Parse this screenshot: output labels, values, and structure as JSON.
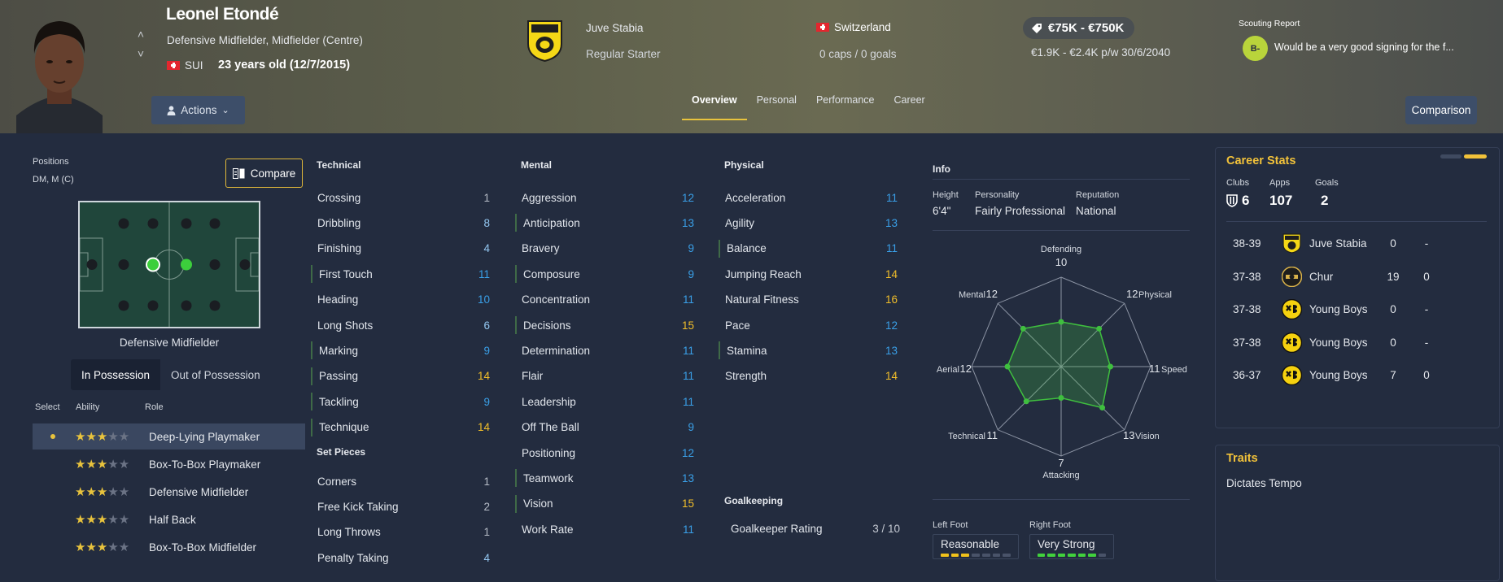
{
  "player": {
    "name": "Leonel Etondé",
    "positions_text": "Defensive Midfielder, Midfielder (Centre)",
    "nationality": "SUI",
    "age_text": "23 years old (12/7/2015)"
  },
  "header": {
    "actions_label": "Actions",
    "club": {
      "name": "Juve Stabia",
      "role": "Regular Starter"
    },
    "international": {
      "country": "Switzerland",
      "caps": "0 caps / 0 goals"
    },
    "value": "€75K - €750K",
    "wage_contract": "€1.9K - €2.4K p/w 30/6/2040",
    "scouting": {
      "title": "Scouting Report",
      "grade": "B-",
      "text": "Would be a very good signing for the f..."
    },
    "tabs": [
      "Overview",
      "Personal",
      "Performance",
      "Career"
    ],
    "active_tab": "Overview",
    "comparison_label": "Comparison"
  },
  "positions": {
    "label": "Positions",
    "value": "DM, M (C)",
    "compare_label": "Compare",
    "selected_role": "Defensive Midfielder",
    "possession_tabs": [
      "In Possession",
      "Out of Possession"
    ],
    "roles_headers": {
      "select": "Select",
      "ability": "Ability",
      "role": "Role"
    },
    "roles": [
      {
        "name": "Deep-Lying Playmaker",
        "stars": 2.5,
        "selected": true
      },
      {
        "name": "Box-To-Box Playmaker",
        "stars": 2.5,
        "selected": false
      },
      {
        "name": "Defensive Midfielder",
        "stars": 2.5,
        "selected": false
      },
      {
        "name": "Half Back",
        "stars": 2.5,
        "selected": false
      },
      {
        "name": "Box-To-Box Midfielder",
        "stars": 2.5,
        "selected": false
      }
    ]
  },
  "technical": {
    "title": "Technical",
    "attrs": [
      {
        "name": "Crossing",
        "value": "1",
        "c": "w"
      },
      {
        "name": "Dribbling",
        "value": "8",
        "c": "lb"
      },
      {
        "name": "Finishing",
        "value": "4",
        "c": "lb"
      },
      {
        "name": "First Touch",
        "value": "11",
        "c": "b",
        "mark": true
      },
      {
        "name": "Heading",
        "value": "10",
        "c": "b"
      },
      {
        "name": "Long Shots",
        "value": "6",
        "c": "lb"
      },
      {
        "name": "Marking",
        "value": "9",
        "c": "b",
        "mark": true
      },
      {
        "name": "Passing",
        "value": "14",
        "c": "y",
        "mark": true
      },
      {
        "name": "Tackling",
        "value": "9",
        "c": "b",
        "mark": true
      },
      {
        "name": "Technique",
        "value": "14",
        "c": "y",
        "mark": true
      }
    ]
  },
  "set_pieces": {
    "title": "Set Pieces",
    "attrs": [
      {
        "name": "Corners",
        "value": "1",
        "c": "w"
      },
      {
        "name": "Free Kick Taking",
        "value": "2",
        "c": "w"
      },
      {
        "name": "Long Throws",
        "value": "1",
        "c": "w"
      },
      {
        "name": "Penalty Taking",
        "value": "4",
        "c": "lb"
      }
    ]
  },
  "mental": {
    "title": "Mental",
    "attrs": [
      {
        "name": "Aggression",
        "value": "12",
        "c": "b"
      },
      {
        "name": "Anticipation",
        "value": "13",
        "c": "b",
        "mark": true
      },
      {
        "name": "Bravery",
        "value": "9",
        "c": "b"
      },
      {
        "name": "Composure",
        "value": "9",
        "c": "b",
        "mark": true
      },
      {
        "name": "Concentration",
        "value": "11",
        "c": "b"
      },
      {
        "name": "Decisions",
        "value": "15",
        "c": "y",
        "mark": true
      },
      {
        "name": "Determination",
        "value": "11",
        "c": "b"
      },
      {
        "name": "Flair",
        "value": "11",
        "c": "b"
      },
      {
        "name": "Leadership",
        "value": "11",
        "c": "b"
      },
      {
        "name": "Off The Ball",
        "value": "9",
        "c": "b"
      },
      {
        "name": "Positioning",
        "value": "12",
        "c": "b"
      },
      {
        "name": "Teamwork",
        "value": "13",
        "c": "b",
        "mark": true
      },
      {
        "name": "Vision",
        "value": "15",
        "c": "y",
        "mark": true
      },
      {
        "name": "Work Rate",
        "value": "11",
        "c": "b"
      }
    ]
  },
  "physical": {
    "title": "Physical",
    "attrs": [
      {
        "name": "Acceleration",
        "value": "11",
        "c": "b"
      },
      {
        "name": "Agility",
        "value": "13",
        "c": "b"
      },
      {
        "name": "Balance",
        "value": "11",
        "c": "b",
        "mark": true
      },
      {
        "name": "Jumping Reach",
        "value": "14",
        "c": "y"
      },
      {
        "name": "Natural Fitness",
        "value": "16",
        "c": "y"
      },
      {
        "name": "Pace",
        "value": "12",
        "c": "b"
      },
      {
        "name": "Stamina",
        "value": "13",
        "c": "b",
        "mark": true
      },
      {
        "name": "Strength",
        "value": "14",
        "c": "y"
      }
    ]
  },
  "goalkeeping": {
    "title": "Goalkeeping",
    "label": "Goalkeeper Rating",
    "value": "3 / 10"
  },
  "info": {
    "title": "Info",
    "height_label": "Height",
    "height": "6'4\"",
    "personality_label": "Personality",
    "personality": "Fairly Professional",
    "reputation_label": "Reputation",
    "reputation": "National",
    "left_foot_label": "Left Foot",
    "left_foot": "Reasonable",
    "left_foot_level": 3,
    "right_foot_label": "Right Foot",
    "right_foot": "Very Strong",
    "right_foot_level": 6
  },
  "radar": {
    "axes": [
      {
        "label": "Defending",
        "value": "10",
        "v": 10
      },
      {
        "label": "Physical",
        "value": "12",
        "v": 12
      },
      {
        "label": "Speed",
        "value": "11",
        "v": 11
      },
      {
        "label": "Vision",
        "value": "13",
        "v": 13
      },
      {
        "label": "Attacking",
        "value": "7",
        "v": 7
      },
      {
        "label": "Technical",
        "value": "11",
        "v": 11
      },
      {
        "label": "Aerial",
        "value": "12",
        "v": 12
      },
      {
        "label": "Mental",
        "value": "12",
        "v": 12
      }
    ],
    "max": 20,
    "color": "#3fbf3f"
  },
  "career_stats": {
    "title": "Career Stats",
    "clubs_label": "Clubs",
    "clubs": "6",
    "apps_label": "Apps",
    "apps": "107",
    "goals_label": "Goals",
    "goals": "2",
    "rows": [
      {
        "season": "38-39",
        "club": "Juve Stabia",
        "apps": "0",
        "goals": "-",
        "crest": "juve"
      },
      {
        "season": "37-38",
        "club": "Chur",
        "apps": "19",
        "goals": "0",
        "crest": "chur"
      },
      {
        "season": "37-38",
        "club": "Young Boys",
        "apps": "0",
        "goals": "-",
        "crest": "yb"
      },
      {
        "season": "37-38",
        "club": "Young Boys",
        "apps": "0",
        "goals": "-",
        "crest": "yb"
      },
      {
        "season": "36-37",
        "club": "Young Boys",
        "apps": "7",
        "goals": "0",
        "crest": "yb"
      }
    ]
  },
  "traits": {
    "title": "Traits",
    "items": [
      "Dictates Tempo"
    ]
  }
}
